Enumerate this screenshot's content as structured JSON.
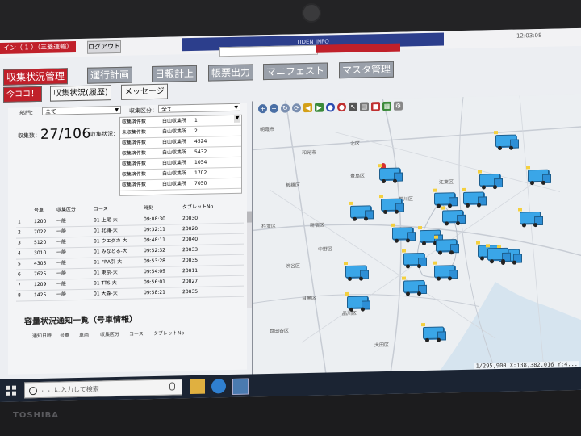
{
  "window": {
    "app_title": "イン（ 1 ）（三菱運輸）",
    "logout_label": "ログアウト",
    "caption": "TIDEN INFO",
    "caption_field": "",
    "clock": "12:03:08"
  },
  "menu": {
    "tabs": [
      {
        "label": "収集状況管理",
        "active": true
      },
      {
        "label": "運行計画",
        "active": false
      },
      {
        "label": "日報計上",
        "active": false
      },
      {
        "label": "帳票出力",
        "active": false
      },
      {
        "label": "マニフェスト",
        "active": false
      },
      {
        "label": "マスタ管理",
        "active": false
      }
    ]
  },
  "subbar": {
    "buttons": [
      {
        "label": "今ココ！",
        "style": "red"
      },
      {
        "label": "収集状況(履歴)",
        "style": "plain"
      },
      {
        "label": "メッセージ",
        "style": "plain"
      }
    ]
  },
  "filters": {
    "dept_label": "部門：",
    "dept_value": "全て",
    "status_label": "収集区分：",
    "status_value": "全て",
    "count_label": "収集数：",
    "count_value": "27/106",
    "progress_label": "収集状況："
  },
  "status_list": [
    {
      "k": "収集済件数",
      "m": "白山収集所",
      "v": "1"
    },
    {
      "k": "未収集件数",
      "m": "白山収集所",
      "v": "2"
    },
    {
      "k": "収集済件数",
      "m": "白山収集所",
      "v": "4524"
    },
    {
      "k": "収集済件数",
      "m": "白山収集所",
      "v": "5432"
    },
    {
      "k": "収集済件数",
      "m": "白山収集所",
      "v": "1054"
    },
    {
      "k": "収集済件数",
      "m": "白山収集所",
      "v": "1702"
    },
    {
      "k": "収集済件数",
      "m": "白山収集所",
      "v": "7050"
    }
  ],
  "vehicle_table": {
    "headers": [
      "号車",
      "収集区分",
      "コース",
      "時刻",
      "タブレットNo"
    ],
    "rows": [
      {
        "n": "1",
        "id": "1200",
        "kind": "一般",
        "course": "01 上尾-大",
        "time": "09:08:30",
        "tab": "20030"
      },
      {
        "n": "2",
        "id": "7022",
        "kind": "一般",
        "course": "01 北浦-大",
        "time": "09:32:11",
        "tab": "20020"
      },
      {
        "n": "3",
        "id": "5120",
        "kind": "一般",
        "course": "01 ウエダカ-大",
        "time": "09:48:11",
        "tab": "20040"
      },
      {
        "n": "4",
        "id": "3010",
        "kind": "一般",
        "course": "01 みなとる-大",
        "time": "09:52:32",
        "tab": "20033"
      },
      {
        "n": "5",
        "id": "4305",
        "kind": "一般",
        "course": "01 FRA引-大",
        "time": "09:53:28",
        "tab": "20035"
      },
      {
        "n": "6",
        "id": "7625",
        "kind": "一般",
        "course": "01 東京-大",
        "time": "09:54:09",
        "tab": "20011"
      },
      {
        "n": "7",
        "id": "1209",
        "kind": "一般",
        "course": "01 TTS-大",
        "time": "09:56:01",
        "tab": "20027"
      },
      {
        "n": "8",
        "id": "1425",
        "kind": "一般",
        "course": "01 大森-大",
        "time": "09:58:21",
        "tab": "20035"
      }
    ]
  },
  "notice": {
    "title": "容量状況通知一覧（号車情報）",
    "headers": [
      "通知日時",
      "号車",
      "車両",
      "収集区分",
      "コース",
      "タブレットNo"
    ]
  },
  "map": {
    "scale_text": "1/295,900 X:138,382,016 Y:4...",
    "place_labels": [
      "朝霞市",
      "和光市",
      "板橋区",
      "北区",
      "荒川区",
      "新宿区",
      "渋谷区",
      "品川区",
      "目黒区",
      "大田区",
      "世田谷区",
      "杉並区",
      "江東区",
      "中野区",
      "豊島区"
    ],
    "truck_color": "#3aa6e8"
  },
  "taskbar": {
    "search_placeholder": "ここに入力して検索"
  },
  "bezel": {
    "brand": "TOSHIBA"
  }
}
